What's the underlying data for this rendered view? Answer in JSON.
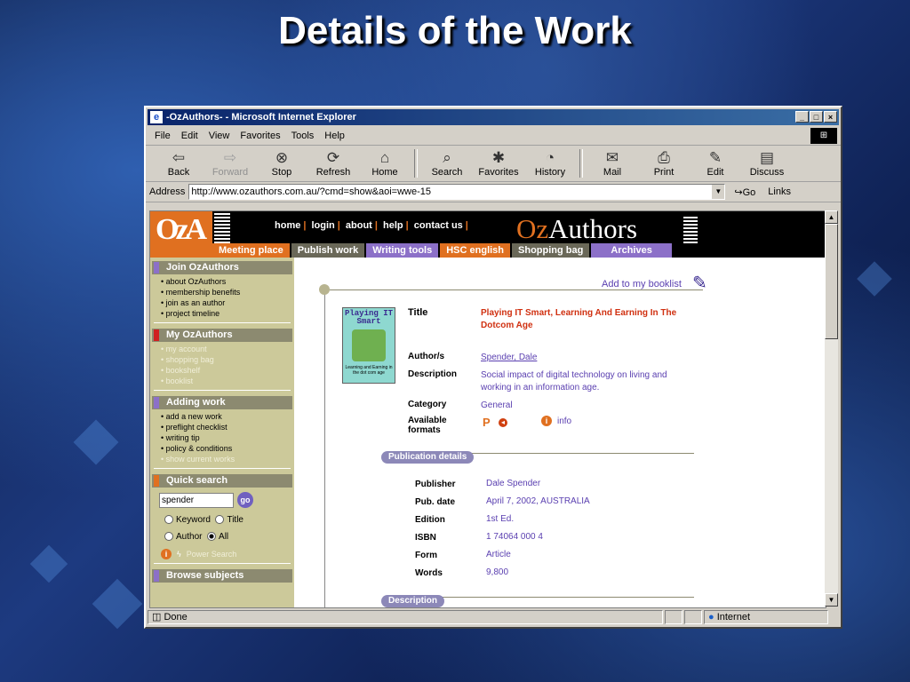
{
  "slide": {
    "title": "Details of the Work"
  },
  "window": {
    "title": "-OzAuthors- - Microsoft Internet Explorer",
    "menu": [
      "File",
      "Edit",
      "View",
      "Favorites",
      "Tools",
      "Help"
    ],
    "toolbar": {
      "back": "Back",
      "forward": "Forward",
      "stop": "Stop",
      "refresh": "Refresh",
      "home": "Home",
      "search": "Search",
      "favorites": "Favorites",
      "history": "History",
      "mail": "Mail",
      "print": "Print",
      "edit": "Edit",
      "discuss": "Discuss"
    },
    "address": {
      "label": "Address",
      "url": "http://www.ozauthors.com.au/?cmd=show&aoi=wwe-15",
      "go": "Go",
      "links": "Links"
    },
    "status": {
      "text": "Done",
      "zone": "Internet"
    }
  },
  "site": {
    "logo": "OzA",
    "brand": {
      "oz": "Oz",
      "authors": "Authors"
    },
    "topnav": [
      "home",
      "login",
      "about",
      "help",
      "contact us"
    ],
    "tabs": [
      {
        "label": "Meeting place",
        "color": "#e07020"
      },
      {
        "label": "Publish work",
        "color": "#6a6858"
      },
      {
        "label": "Writing tools",
        "color": "#8c70c8"
      },
      {
        "label": "HSC english",
        "color": "#e07020"
      },
      {
        "label": "Shopping bag",
        "color": "#6a6858"
      },
      {
        "label": "Archives",
        "color": "#8c70c8"
      }
    ],
    "sidebar": {
      "join": {
        "heading": "Join OzAuthors",
        "items": [
          "about OzAuthors",
          "membership benefits",
          "join as an author",
          "project timeline"
        ]
      },
      "my": {
        "heading": "My OzAuthors",
        "items": [
          "my account",
          "shopping bag",
          "bookshelf",
          "booklist"
        ]
      },
      "adding": {
        "heading": "Adding work",
        "items": [
          "add a new work",
          "preflight checklist",
          "writing tip",
          "policy & conditions"
        ],
        "dim_item": "show current works"
      },
      "search": {
        "heading": "Quick search",
        "value": "spender",
        "go": "go",
        "keyword": "Keyword",
        "title": "Title",
        "author": "Author",
        "all": "All",
        "power": "Power Search"
      },
      "browse": {
        "heading": "Browse subjects"
      }
    },
    "work": {
      "add_booklist": "Add to my booklist",
      "book_cover_title": "Playing IT Smart",
      "book_cover_sub": "Learning and Earning in the dot com age",
      "title_label": "Title",
      "title": "Playing IT Smart, Learning And Earning In The Dotcom Age",
      "author_label": "Author/s",
      "author": "Spender, Dale",
      "desc_label": "Description",
      "desc": "Social impact of digital technology on living and working in an information age.",
      "cat_label": "Category",
      "category": "General",
      "formats_label": "Available formats",
      "format_p": "P",
      "format_info": "info"
    },
    "publication": {
      "heading": "Publication details",
      "rows": [
        {
          "label": "Publisher",
          "value": "Dale Spender"
        },
        {
          "label": "Pub. date",
          "value": "April 7, 2002, AUSTRALIA"
        },
        {
          "label": "Edition",
          "value": "1st Ed."
        },
        {
          "label": "ISBN",
          "value": "1 74064 000 4"
        },
        {
          "label": "Form",
          "value": "Article"
        },
        {
          "label": "Words",
          "value": "9,800"
        }
      ],
      "description_heading": "Description"
    }
  }
}
